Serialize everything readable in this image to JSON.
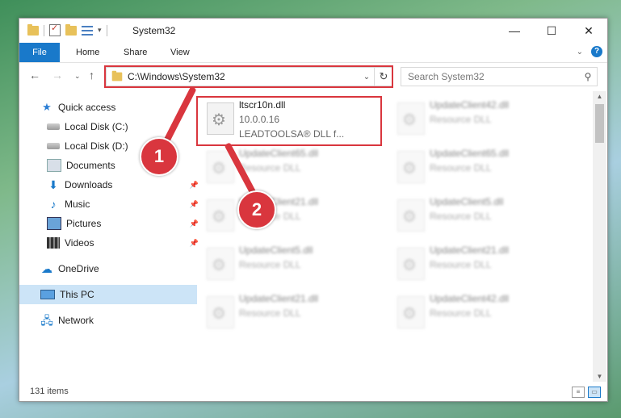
{
  "window": {
    "title": "System32"
  },
  "ribbon": {
    "file": "File",
    "home": "Home",
    "share": "Share",
    "view": "View"
  },
  "address": {
    "path": "C:\\Windows\\System32"
  },
  "search": {
    "placeholder": "Search System32"
  },
  "nav": [
    {
      "label": "Quick access",
      "icon": "star-icon"
    },
    {
      "label": "Local Disk (C:)",
      "icon": "drive-icon"
    },
    {
      "label": "Local Disk (D:)",
      "icon": "drive-icon"
    },
    {
      "label": "Documents",
      "icon": "documents-icon"
    },
    {
      "label": "Downloads",
      "icon": "download-icon"
    },
    {
      "label": "Music",
      "icon": "music-icon"
    },
    {
      "label": "Pictures",
      "icon": "pictures-icon"
    },
    {
      "label": "Videos",
      "icon": "videos-icon"
    },
    {
      "label": "OneDrive",
      "icon": "cloud-icon"
    },
    {
      "label": "This PC",
      "icon": "computer-icon"
    },
    {
      "label": "Network",
      "icon": "network-icon"
    }
  ],
  "files": [
    {
      "name": "ltscr10n.dll",
      "line2": "10.0.0.16",
      "line3": "LEADTOOLSA® DLL f..."
    },
    {
      "name": "UpdateClient42.dll",
      "line2": "Resource DLL"
    },
    {
      "name": "UpdateClient65.dll",
      "line2": "Resource DLL"
    },
    {
      "name": "UpdateClient65.dll",
      "line2": "Resource DLL"
    },
    {
      "name": "UpdateClient21.dll",
      "line2": "Resource DLL"
    },
    {
      "name": "UpdateClient5.dll",
      "line2": "Resource DLL"
    },
    {
      "name": "UpdateClient5.dll",
      "line2": "Resource DLL"
    },
    {
      "name": "UpdateClient21.dll",
      "line2": "Resource DLL"
    },
    {
      "name": "UpdateClient21.dll",
      "line2": "Resource DLL"
    },
    {
      "name": "UpdateClient42.dll",
      "line2": "Resource DLL"
    }
  ],
  "status": {
    "count": "131 items"
  },
  "annotations": {
    "badge1": "1",
    "badge2": "2",
    "color": "#d9363e"
  },
  "colors": {
    "accent": "#1979ca",
    "selection": "#cce4f7"
  }
}
